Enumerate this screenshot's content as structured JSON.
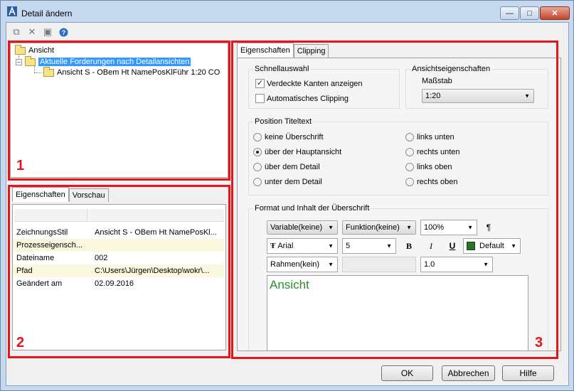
{
  "window": {
    "title": "Detail ändern"
  },
  "toolbar": {
    "icons": [
      "copy-icon",
      "delete-icon",
      "save-icon",
      "help-icon"
    ]
  },
  "tree": {
    "root": "Ansicht",
    "child": "Aktuelle Forderungen nach Detailansichten",
    "grandchild": "Ansicht S - OBem Ht NamePosKlFühr 1:20 CO"
  },
  "annotations": {
    "one": "1",
    "two": "2",
    "three": "3"
  },
  "left_tabs": {
    "properties": "Eigenschaften",
    "preview": "Vorschau"
  },
  "properties": [
    {
      "key": "ZeichnungsStil",
      "value": "Ansicht S - OBem Ht NamePosKl..."
    },
    {
      "key": "Prozesseigensch...",
      "value": ""
    },
    {
      "key": "Dateiname",
      "value": "002"
    },
    {
      "key": "Pfad",
      "value": "C:\\Users\\Jürgen\\Desktop\\wokr\\..."
    },
    {
      "key": "Geändert am",
      "value": "02.09.2016"
    }
  ],
  "right_tabs": {
    "properties": "Eigenschaften",
    "clipping": "Clipping"
  },
  "quick": {
    "title": "Schnellauswahl",
    "hidden_edges": "Verdeckte Kanten anzeigen",
    "auto_clipping": "Automatisches Clipping"
  },
  "view_props": {
    "title": "Ansichtseigenschaften",
    "scale_label": "Maßstab",
    "scale_value": "1:20"
  },
  "title_position": {
    "title": "Position Titeltext",
    "options": [
      "keine Überschrift",
      "über der Hauptansicht",
      "über dem Detail",
      "unter dem Detail",
      "links unten",
      "rechts unten",
      "links oben",
      "rechts oben"
    ],
    "selected": "über der Hauptansicht"
  },
  "format": {
    "title": "Format und Inhalt der Überschrift",
    "variable": "Variable(keine)",
    "function": "Funktion(keine)",
    "zoom": "100%",
    "paragraph": "¶",
    "font_prefix": "Ŧ",
    "font": "Arial",
    "size": "5",
    "bold": "B",
    "italic": "I",
    "underline": "U",
    "color_name": "Default",
    "color": "#1f7a1f",
    "frame": "Rahmen(kein)",
    "spacing": "1.0",
    "text": "Ansicht",
    "text_color": "#2c8c2c"
  },
  "buttons": {
    "ok": "OK",
    "cancel": "Abbrechen",
    "help": "Hilfe"
  },
  "colors": {
    "highlight": "#3399ff",
    "annotation": "#e3161b"
  }
}
